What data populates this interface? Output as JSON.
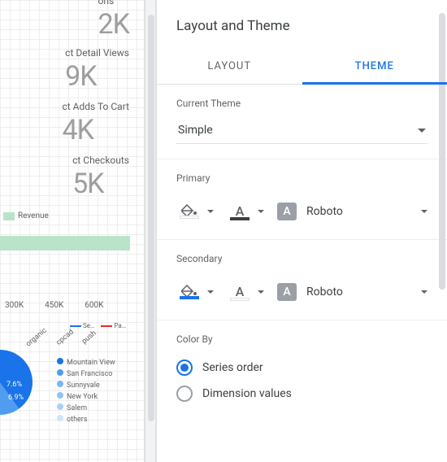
{
  "canvas": {
    "metrics": [
      {
        "label": "ons",
        "value": "2K"
      },
      {
        "label": "ct Detail Views",
        "value": "9K"
      },
      {
        "label": "ct Adds To Cart",
        "value": "4K"
      },
      {
        "label": "ct Checkouts",
        "value": "5K"
      }
    ],
    "revenue_swatch": "Revenue",
    "axis_ticks": [
      "300K",
      "450K",
      "600K"
    ],
    "mini_legend": [
      "Se…",
      "Pa…"
    ],
    "source_labels": [
      "organic",
      "cpcad",
      "push"
    ],
    "pie_labels": [
      "7.6%",
      "6.9%"
    ],
    "cities": [
      {
        "name": "Mountain View",
        "color": "#1a73e8"
      },
      {
        "name": "San Francisco",
        "color": "#4f9cf0"
      },
      {
        "name": "Sunnyvale",
        "color": "#7bb6f5"
      },
      {
        "name": "New York",
        "color": "#8ec3f8"
      },
      {
        "name": "Salem",
        "color": "#a7d0fa"
      },
      {
        "name": "others",
        "color": "#cde5fd"
      }
    ]
  },
  "panel": {
    "title": "Layout and Theme",
    "tabs": {
      "layout": "LAYOUT",
      "theme": "THEME"
    },
    "current_theme": {
      "label": "Current Theme",
      "value": "Simple"
    },
    "primary": {
      "label": "Primary",
      "font": "Roboto"
    },
    "secondary": {
      "label": "Secondary",
      "font": "Roboto"
    },
    "color_by": {
      "label": "Color By",
      "options": {
        "series": "Series order",
        "dimension": "Dimension values"
      },
      "selected": "series"
    },
    "glyphs": {
      "letter_a": "A"
    }
  }
}
